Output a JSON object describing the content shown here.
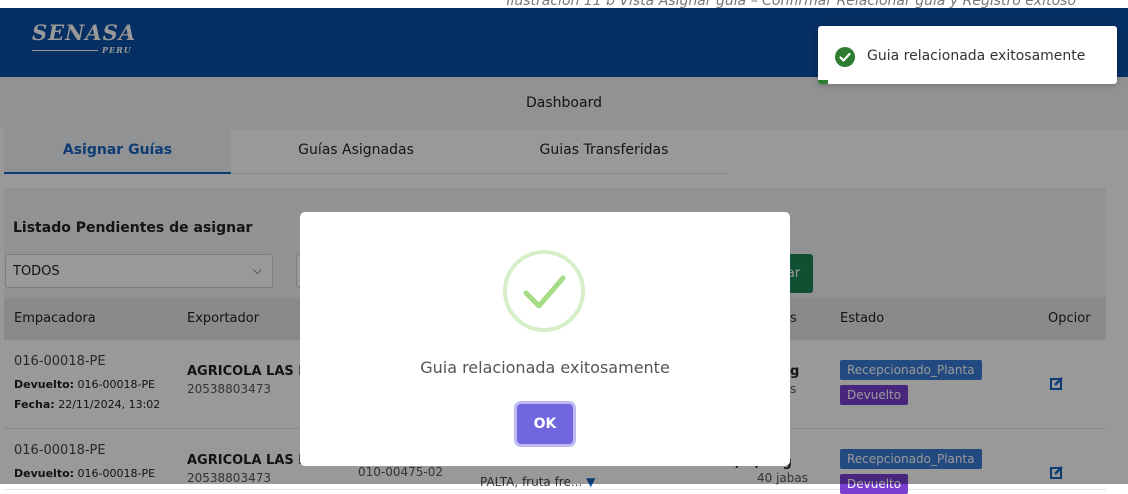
{
  "caption": "Ilustración 11 b Vista Asignar guía – Confirmar Relacionar guía y Registro exitoso",
  "brand": {
    "name": "SENASA",
    "sub": "PERU"
  },
  "header": {
    "title": "Dashboard"
  },
  "tabs": [
    {
      "label": "Asignar Guías",
      "active": true
    },
    {
      "label": "Guías Asignadas",
      "active": false
    },
    {
      "label": "Guias Transferidas",
      "active": false
    }
  ],
  "list": {
    "title": "Listado Pendientes de asignar",
    "filter_value": "TODOS",
    "action_button_label": "ar"
  },
  "table": {
    "columns": [
      "Empacadora",
      "Exportador",
      "s",
      "Estado",
      "Opcior"
    ],
    "rows": [
      {
        "empacadora": "016-00018-PE",
        "devuelto_label": "Devuelto:",
        "devuelto_value": "016-00018-PE",
        "fecha_label": "Fecha:",
        "fecha_value": "22/11/2024, 13:02",
        "exportador": "AGRICOLA LAS MA",
        "ruc": "20538803473",
        "peso": "g",
        "jabas": "s",
        "estado": [
          "Recepcionado_Planta",
          "Devuelto"
        ]
      },
      {
        "empacadora": "016-00018-PE",
        "devuelto_label": "Devuelto:",
        "devuelto_value": "016-00018-PE",
        "exportador": "AGRICOLA LAS MA...",
        "ruc": "20538803473",
        "guia": "010-00475-02",
        "producto": "PALTA, fruta fre...",
        "peso": "...,...,.. kg",
        "jabas": "40 jabas",
        "estado": [
          "Recepcionado_Planta",
          "Devuelto"
        ]
      }
    ]
  },
  "modal": {
    "message": "Guia relacionada exitosamente",
    "ok_label": "OK"
  },
  "toast": {
    "message": "Guia relacionada exitosamente"
  },
  "colors": {
    "primary": "#0b4fa5",
    "tab_active": "#1565c0",
    "success": "#198754",
    "badge_blue": "#3a7bd5",
    "badge_purple": "#7b40d1",
    "ok_button": "#7066e0",
    "check_green": "#a5dc86"
  }
}
